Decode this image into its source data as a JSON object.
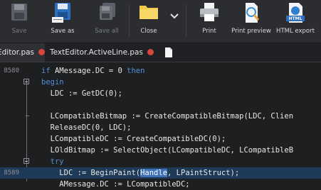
{
  "toolbar": {
    "buttons": [
      {
        "label": "Save",
        "icon": "floppy-icon",
        "enabled": false
      },
      {
        "label": "Save as",
        "icon": "floppy-as-icon",
        "enabled": true
      },
      {
        "label": "Save all",
        "icon": "floppy-multiple-icon",
        "enabled": false
      },
      {
        "label": "Close",
        "icon": "folder-icon",
        "enabled": true
      },
      {
        "label": "Print",
        "icon": "printer-icon",
        "enabled": true
      },
      {
        "label": "Print preview",
        "icon": "print-preview-icon",
        "enabled": true
      },
      {
        "label": "HTML export",
        "icon": "html-export-icon",
        "enabled": true,
        "badge": "HTML"
      }
    ]
  },
  "tabs": [
    {
      "label": "Editor.pas",
      "active": true,
      "modified": true
    },
    {
      "label": "TextEditor.ActiveLine.pas",
      "active": false,
      "modified": true
    }
  ],
  "editor": {
    "lines": [
      {
        "number": "8580",
        "marker": "none",
        "indent": "",
        "tokens": [
          [
            "kw",
            "if"
          ],
          [
            "t",
            " AMessage.DC = "
          ],
          [
            "n",
            "0"
          ],
          [
            "t",
            " "
          ],
          [
            "kw",
            "then"
          ]
        ]
      },
      {
        "number": "",
        "marker": "fold",
        "indent": "",
        "tokens": [
          [
            "kw",
            "begin"
          ]
        ]
      },
      {
        "number": "",
        "marker": "none",
        "indent": "  ",
        "tokens": [
          [
            "t",
            "LDC := GetDC("
          ],
          [
            "n",
            "0"
          ],
          [
            "t",
            ");"
          ]
        ]
      },
      {
        "number": "",
        "marker": "none",
        "indent": "",
        "tokens": []
      },
      {
        "number": "",
        "marker": "dash",
        "indent": "  ",
        "tokens": [
          [
            "t",
            "LCompatibleBitmap := CreateCompatibleBitmap(LDC, Clien"
          ]
        ]
      },
      {
        "number": "",
        "marker": "none",
        "indent": "  ",
        "tokens": [
          [
            "t",
            "ReleaseDC("
          ],
          [
            "n",
            "0"
          ],
          [
            "t",
            ", LDC);"
          ]
        ]
      },
      {
        "number": "",
        "marker": "none",
        "indent": "  ",
        "tokens": [
          [
            "t",
            "LCompatibleDC := CreateCompatibleDC("
          ],
          [
            "n",
            "0"
          ],
          [
            "t",
            ");"
          ]
        ]
      },
      {
        "number": "",
        "marker": "none",
        "indent": "  ",
        "tokens": [
          [
            "t",
            "LOldBitmap := SelectObject(LCompatibleDC, LCompatibleB"
          ]
        ]
      },
      {
        "number": "",
        "marker": "fold",
        "indent": "  ",
        "tokens": [
          [
            "kw",
            "try"
          ]
        ]
      },
      {
        "number": "8589",
        "marker": "none",
        "indent": "    ",
        "highlight": true,
        "tokens": [
          [
            "t",
            "LDC := BeginPaint("
          ],
          [
            "s",
            "Handle"
          ],
          [
            "t",
            ", LPaintStruct);"
          ]
        ]
      },
      {
        "number": "",
        "marker": "none",
        "indent": "    ",
        "tokens": [
          [
            "t",
            "AMessage.DC := LCompatibleDC;"
          ]
        ]
      }
    ]
  }
}
